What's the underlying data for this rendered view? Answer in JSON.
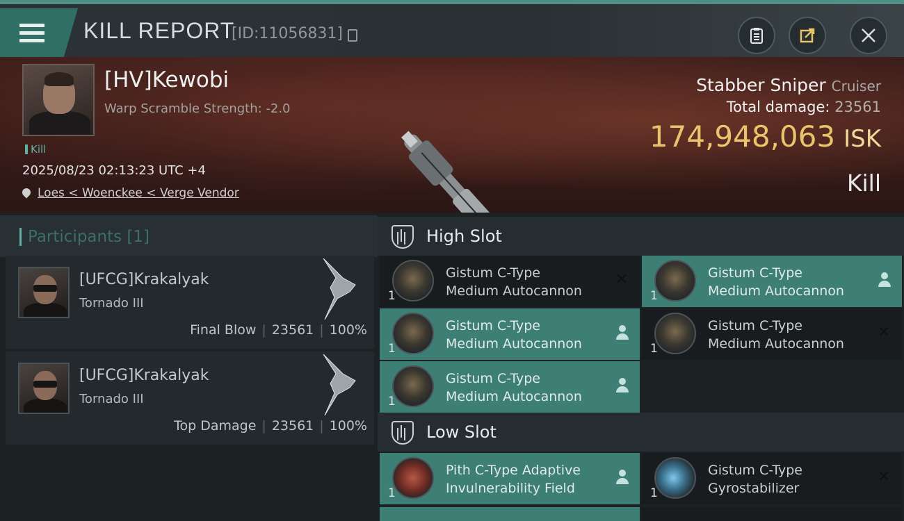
{
  "header": {
    "title": "KILL REPORT",
    "report_id": "[ID:11056831]",
    "icons": [
      "menu-icon",
      "copy-icon",
      "clipboard-icon",
      "share-icon",
      "close-icon"
    ]
  },
  "victim": {
    "name": "[HV]Kewobi",
    "warp_scramble": "Warp Scramble Strength: -2.0",
    "tag": "Kill",
    "datetime": "2025/08/23 02:13:23 UTC +4",
    "location": "Loes < Woenckee < Verge Vendor",
    "ship": "Stabber Sniper",
    "ship_class": "Cruiser",
    "total_damage_label": "Total damage:",
    "total_damage": "23561",
    "isk_value": "174,948,063",
    "isk_unit": "ISK",
    "result": "Kill"
  },
  "participants": {
    "label": "Participants",
    "count": "[1]",
    "rows": [
      {
        "name": "[UFCG]Krakalyak",
        "ship": "Tornado III",
        "role": "Final Blow",
        "damage": "23561",
        "percent": "100%"
      },
      {
        "name": "[UFCG]Krakalyak",
        "ship": "Tornado III",
        "role": "Top Damage",
        "damage": "23561",
        "percent": "100%"
      }
    ]
  },
  "slots": {
    "high": {
      "label": "High Slot",
      "modules": [
        {
          "line1": "Gistum C-Type",
          "line2": "Medium Autocannon",
          "qty": "1",
          "status": "destroyed"
        },
        {
          "line1": "Gistum C-Type",
          "line2": "Medium Autocannon",
          "qty": "1",
          "status": "dropped"
        },
        {
          "line1": "Gistum C-Type",
          "line2": "Medium Autocannon",
          "qty": "1",
          "status": "dropped"
        },
        {
          "line1": "Gistum C-Type",
          "line2": "Medium Autocannon",
          "qty": "1",
          "status": "destroyed"
        },
        {
          "line1": "Gistum C-Type",
          "line2": "Medium Autocannon",
          "qty": "1",
          "status": "dropped"
        }
      ]
    },
    "low": {
      "label": "Low Slot",
      "modules": [
        {
          "line1": "Pith C-Type Adaptive",
          "line2": "Invulnerability Field",
          "qty": "1",
          "status": "dropped"
        },
        {
          "line1": "Gistum C-Type",
          "line2": "Gyrostabilizer",
          "qty": "1",
          "status": "destroyed"
        }
      ]
    }
  },
  "colors": {
    "accent": "#4f8f86",
    "isk": "#e8c46c",
    "dropped_bg": "#3d7e75"
  }
}
